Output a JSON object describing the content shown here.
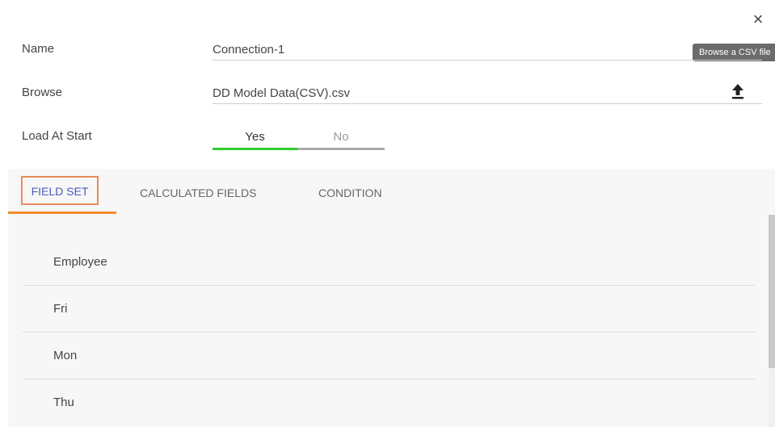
{
  "dialog": {
    "close_icon": "close-icon",
    "tooltip": "Browse a CSV file"
  },
  "form": {
    "name_label": "Name",
    "name_value": "Connection-1",
    "browse_label": "Browse",
    "browse_value": "DD Model Data(CSV).csv",
    "upload_icon": "upload-icon",
    "load_label": "Load At Start",
    "toggle": {
      "yes": "Yes",
      "no": "No",
      "selected": "Yes"
    }
  },
  "tabs": [
    {
      "label": "FIELD SET",
      "active": true
    },
    {
      "label": "CALCULATED FIELDS",
      "active": false
    },
    {
      "label": "CONDITION",
      "active": false
    }
  ],
  "fields": [
    "Employee",
    "Fri",
    "Mon",
    "Thu"
  ],
  "colors": {
    "tab_active_underline": "#f28c28",
    "tab_highlight_box": "#e88b5e",
    "tab_active_text": "#4a5bb8",
    "toggle_on": "#2ecc2e"
  }
}
